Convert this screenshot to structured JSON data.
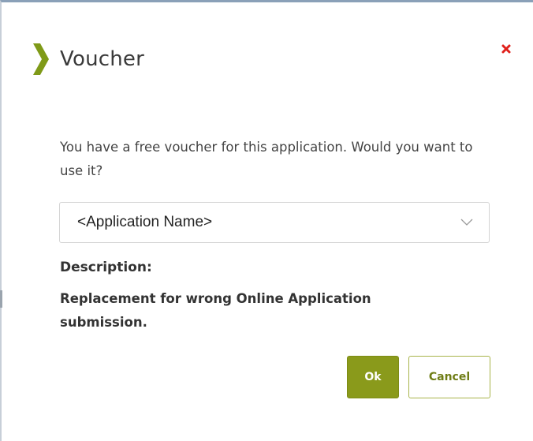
{
  "dialog": {
    "title": "Voucher",
    "message": "You have a free voucher for this application. Would you want to use it?",
    "select": {
      "selected_value": "<Application Name>"
    },
    "description": {
      "label": "Description:",
      "text": "Replacement for wrong Online Application submission."
    },
    "buttons": {
      "ok_label": "Ok",
      "cancel_label": "Cancel"
    },
    "icons": {
      "header": "chevron-right-icon",
      "close": "close-icon",
      "dropdown": "chevron-down-icon"
    }
  },
  "colors": {
    "accent": "#8a9a1b",
    "close": "#e0201b",
    "chevron": "#7f9a18"
  }
}
